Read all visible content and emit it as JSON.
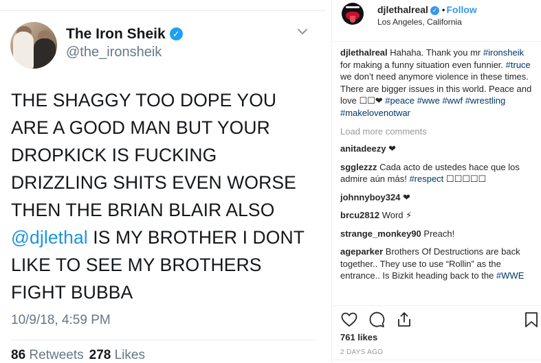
{
  "tweet": {
    "name": "The Iron Sheik",
    "handle": "@the_ironsheik",
    "lines": [
      "THE SHAGGY TOO DOPE YOU",
      "ARE A GOOD MAN BUT YOUR",
      "DROPKICK IS FUCKING",
      "DRIZZLING SHITS EVEN WORSE",
      "THEN THE BRIAN BLAIR ALSO"
    ],
    "mention": "@djlethal",
    "mention_rest": " IS MY BROTHER I DONT",
    "lines_after": [
      "LIKE TO SEE MY BROTHERS",
      "FIGHT BUBBA"
    ],
    "timestamp": "10/9/18, 4:59 PM",
    "retweets_count": "86",
    "retweets_label": "Retweets",
    "likes_count": "278",
    "likes_label": "Likes",
    "icons": {
      "verified": "verified-badge-icon",
      "menu": "chevron-down-icon"
    },
    "colors": {
      "link": "#1b95e0",
      "secondary": "#657786",
      "verified": "#1da1f2"
    }
  },
  "instagram": {
    "username": "djlethalreal",
    "follow_label": "Follow",
    "dot": "•",
    "location": "Los Angeles, California",
    "caption": {
      "user": "djlethalreal",
      "t1": " Hahaha. Thank you mr ",
      "tag1": "#ironsheik",
      "t2": " for making a funny situation even funnier. ",
      "tag2": "#truce",
      "t3": " we don’t need anymore violence in these times. There are bigger issues in this world. Peace and love ☐☐❤ ",
      "tag3": "#peace",
      "tag4": "#wwe",
      "tag5": "#wwf",
      "tag6": "#wrestling",
      "tag7": "#makelovenotwar"
    },
    "load_more": "Load more comments",
    "comments": [
      {
        "user": "anitadeezy",
        "text": " ❤"
      },
      {
        "user": "sgglezzz",
        "text": " Cada acto de ustedes hace que los admire aún más! ",
        "tag": "#respect",
        "tail": " ☐☐☐☐☐"
      },
      {
        "user": "johnnyboy324",
        "text": " ❤"
      },
      {
        "user": "brcu2812",
        "text": " Word ⚡"
      },
      {
        "user": "strange_monkey90",
        "text": " Preach!"
      },
      {
        "user": "ageparker",
        "text": " Brothers Of Destructions are back together.. They use to use “Rollin” as the entrance.. Is Bizkit heading back to the ",
        "tag": "#WWE"
      }
    ],
    "likes": "761 likes",
    "date": "2 DAYS AGO",
    "icons": {
      "like": "heart-icon",
      "comment": "comment-icon",
      "share": "share-icon",
      "save": "bookmark-icon"
    },
    "colors": {
      "link": "#003569",
      "follow": "#3897f0",
      "muted": "#999999"
    }
  }
}
